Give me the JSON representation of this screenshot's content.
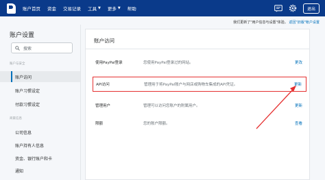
{
  "topnav": {
    "items": [
      {
        "label": "账户首页",
        "caret": false
      },
      {
        "label": "资金",
        "caret": false
      },
      {
        "label": "交易记录",
        "caret": false
      },
      {
        "label": "工具",
        "caret": true
      },
      {
        "label": "更多",
        "caret": true
      },
      {
        "label": "帮助",
        "caret": false
      }
    ],
    "logout_label": "退出"
  },
  "notice": {
    "text": "我们更新了\"用户信息与设置\"体验。",
    "link": "返回\"旧版\"帐户设置"
  },
  "sidebar": {
    "title": "账户设置",
    "search_placeholder": "搜索",
    "section1": "账户与安全",
    "items1": [
      "账户访问",
      "账户习惯设定",
      "付款习惯设定"
    ],
    "section2": "商家信息",
    "items2": [
      "公司信息",
      "账户持有人信息",
      "资金、银行账户和卡",
      "通知"
    ]
  },
  "panel": {
    "title": "账户访问",
    "rows": [
      {
        "label": "使用PayPal登录",
        "desc": "您使用PayPal登录过的网站。",
        "action": "更改"
      },
      {
        "label": "API访问",
        "desc": "管理用于将PayPal账户与网店或购物车集成的API凭证。",
        "action": "更新"
      },
      {
        "label": "管理用户",
        "desc": "管理可以访问您账户的附属用户。",
        "action": "更新"
      },
      {
        "label": "限额",
        "desc": "您的账户限额。",
        "action": "查看"
      }
    ]
  },
  "colors": {
    "topbar": "#0a3a8a",
    "link": "#0070ba",
    "highlight": "#e52f2f"
  },
  "icons": [
    "paypal-logo",
    "chevron-down-icon",
    "message-center-icon",
    "gear-icon",
    "search-icon"
  ]
}
